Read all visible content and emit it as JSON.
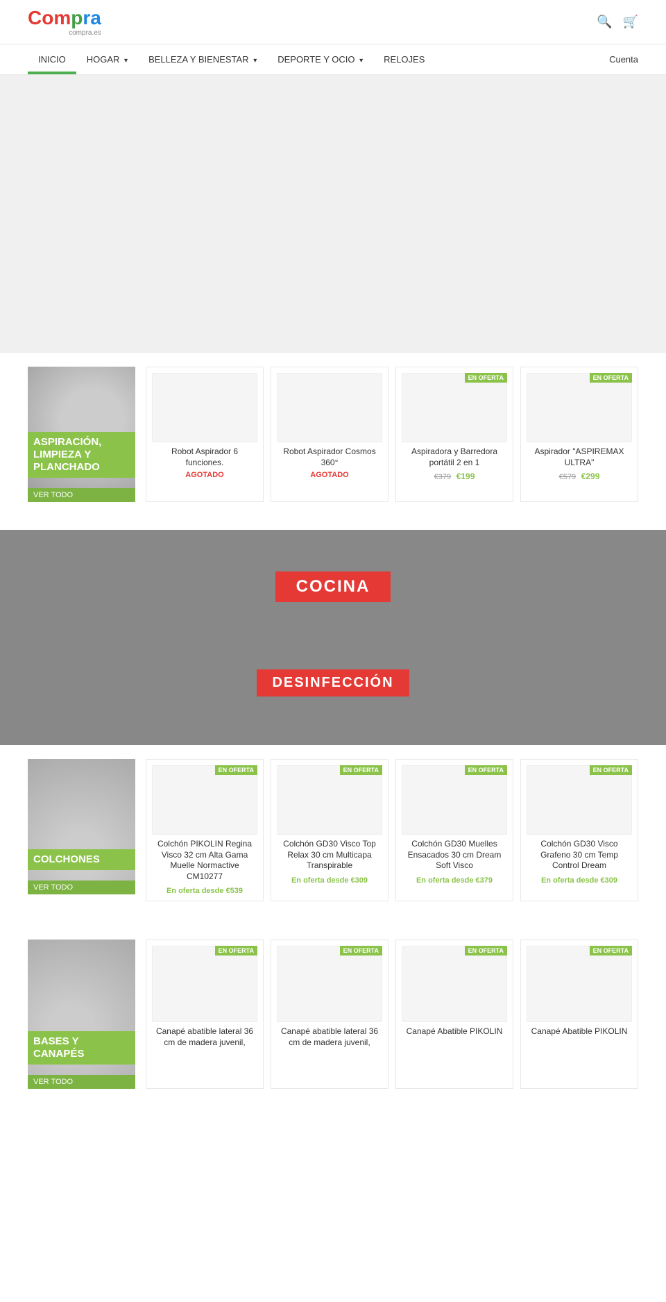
{
  "header": {
    "logo_main": "Compra",
    "logo_co": "Co",
    "logo_m": "m",
    "logo_p": "p",
    "logo_ra": "ra",
    "logo_rest": "",
    "logo_sub": "compra.es",
    "search_icon": "🔍",
    "cart_icon": "🛒"
  },
  "nav": {
    "items": [
      {
        "label": "INICIO",
        "active": true,
        "arrow": false
      },
      {
        "label": "HOGAR",
        "active": false,
        "arrow": true
      },
      {
        "label": "BELLEZA Y BIENESTAR",
        "active": false,
        "arrow": true
      },
      {
        "label": "DEPORTE Y OCIO",
        "active": false,
        "arrow": true
      },
      {
        "label": "RELOJES",
        "active": false,
        "arrow": false
      }
    ],
    "account_label": "Cuenta"
  },
  "aspiracion_section": {
    "banner_label": "ASPIRACIÓN, LIMPIEZA Y PLANCHADO",
    "ver_todo": "VER TODO",
    "products": [
      {
        "name": "Robot Aspirador 6 funciones.",
        "badge": null,
        "status": "AGOTADO",
        "old_price": null,
        "new_price": null
      },
      {
        "name": "Robot Aspirador Cosmos 360°",
        "badge": null,
        "status": "AGOTADO",
        "old_price": null,
        "new_price": null
      },
      {
        "name": "Aspiradora y Barredora portátil 2 en 1",
        "badge": "EN OFERTA",
        "status": null,
        "old_price": "€379",
        "new_price": "€199"
      },
      {
        "name": "Aspirador \"ASPIREMAX ULTRA\"",
        "badge": "EN OFERTA",
        "status": null,
        "old_price": "€579",
        "new_price": "€299"
      }
    ]
  },
  "mid_banner": {
    "title": "COCINA",
    "subtitle": "DESINFECCIÓN"
  },
  "colchones_section": {
    "banner_label": "COLCHONES",
    "ver_todo": "VER TODO",
    "products": [
      {
        "name": "Colchón PIKOLIN Regina Visco 32 cm Alta Gama Muelle Normactive CM10277",
        "badge": "EN OFERTA",
        "status": null,
        "old_price": null,
        "new_price": "En oferta desde €539"
      },
      {
        "name": "Colchón GD30 Visco Top Relax 30 cm Multicapa Transpirable",
        "badge": "EN OFERTA",
        "status": null,
        "old_price": null,
        "new_price": "En oferta desde €309"
      },
      {
        "name": "Colchón GD30 Muelles Ensacados 30 cm Dream Soft Visco",
        "badge": "EN OFERTA",
        "status": null,
        "old_price": null,
        "new_price": "En oferta desde €379"
      },
      {
        "name": "Colchón GD30 Visco Grafeno 30 cm Temp Control Dream",
        "badge": "EN OFERTA",
        "status": null,
        "old_price": null,
        "new_price": "En oferta desde €309"
      }
    ]
  },
  "bases_section": {
    "banner_label": "BASES Y CANAPÉS",
    "ver_todo": "VER TODO",
    "products": [
      {
        "name": "Canapé abatible lateral 36 cm de madera juvenil,",
        "badge": "EN OFERTA",
        "status": null,
        "old_price": null,
        "new_price": null
      },
      {
        "name": "Canapé abatible lateral 36 cm de madera juvenil,",
        "badge": "EN OFERTA",
        "status": null,
        "old_price": null,
        "new_price": null
      },
      {
        "name": "Canapé Abatible PIKOLIN",
        "badge": "EN OFERTA",
        "status": null,
        "old_price": null,
        "new_price": null
      },
      {
        "name": "Canapé Abatible PIKOLIN",
        "badge": "EN OFERTA",
        "status": null,
        "old_price": null,
        "new_price": null
      }
    ]
  }
}
